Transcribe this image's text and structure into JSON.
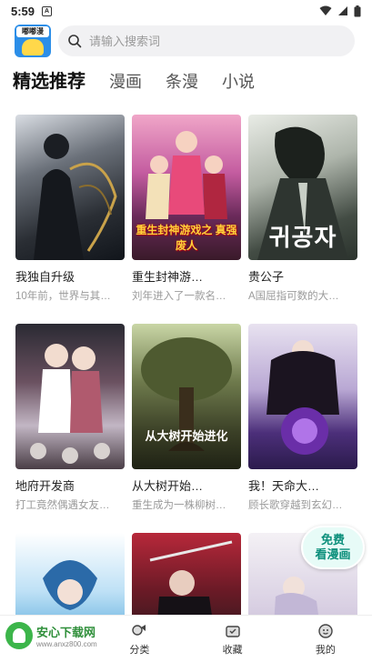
{
  "status": {
    "time": "5:59"
  },
  "app": {
    "logo_text": "嘟嘟漫"
  },
  "search": {
    "placeholder": "请输入搜索词"
  },
  "tabs": [
    {
      "label": "精选推荐",
      "active": true
    },
    {
      "label": "漫画",
      "active": false
    },
    {
      "label": "条漫",
      "active": false
    },
    {
      "label": "小说",
      "active": false
    }
  ],
  "comics": [
    {
      "title": "我独自升级",
      "desc": "10年前，世界与其…",
      "cover_text": ""
    },
    {
      "title": "重生封神游…",
      "desc": "刘年进入了一款名…",
      "cover_text": "重生封神游戏之 真强废人"
    },
    {
      "title": "贵公子",
      "desc": "A国屈指可数的大…",
      "cover_text": "귀공자"
    },
    {
      "title": "地府开发商",
      "desc": "打工竟然偶遇女友…",
      "cover_text": ""
    },
    {
      "title": "从大树开始…",
      "desc": "重生成为一株柳树…",
      "cover_text": "从大树开始进化"
    },
    {
      "title": "我！天命大…",
      "desc": "顾长歌穿越到玄幻…",
      "cover_text": ""
    },
    {
      "title": "",
      "desc": "",
      "cover_text": ""
    },
    {
      "title": "",
      "desc": "",
      "cover_text": ""
    },
    {
      "title": "",
      "desc": "",
      "cover_text": ""
    }
  ],
  "free_badge": {
    "line1": "免费",
    "line2": "看漫画"
  },
  "bottom_nav": [
    {
      "label": ""
    },
    {
      "label": "分类"
    },
    {
      "label": "收藏"
    },
    {
      "label": "我的"
    }
  ],
  "watermark": {
    "name": "安心下载网",
    "url": "www.anxz800.com"
  },
  "colors": {
    "accent": "#0b8f7b",
    "tab_highlight": "#bfe3f5",
    "search_bg": "#f1f1f3"
  }
}
